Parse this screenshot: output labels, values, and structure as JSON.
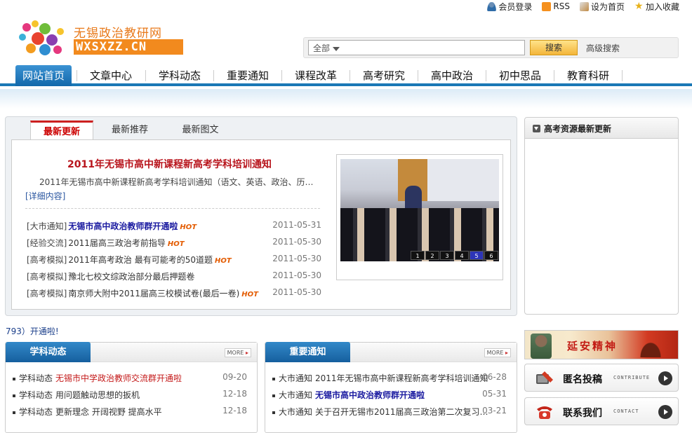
{
  "logo": {
    "brand": "无锡政治教研网",
    "domain": "WXSXZZ.CN"
  },
  "toplinks": [
    {
      "label": "会员登录",
      "icon": "user-icon"
    },
    {
      "label": "RSS",
      "icon": "rss-icon"
    },
    {
      "label": "设为首页",
      "icon": "home-icon"
    },
    {
      "label": "加入收藏",
      "icon": "star-icon"
    }
  ],
  "search": {
    "scope": "全部",
    "button": "搜索",
    "advanced": "高级搜索"
  },
  "nav": [
    "网站首页",
    "文章中心",
    "学科动态",
    "重要通知",
    "课程改革",
    "高考研究",
    "高中政治",
    "初中思品",
    "教育科研"
  ],
  "main": {
    "tabs": [
      "最新更新",
      "最新推荐",
      "最新图文"
    ],
    "featured": {
      "title": "2011年无锡市高中新课程新高考学科培训通知",
      "desc": "2011年无锡市高中新课程新高考学科培训通知（语文、英语、政治、历…",
      "more": "[详细内容]"
    },
    "news": [
      {
        "cat": "[大市通知]",
        "title": "无锡市高中政治教师群开通啦",
        "hot": "HOT",
        "date": "2011-05-31",
        "strong": true
      },
      {
        "cat": "[经验交流]",
        "title": "2011届高三政治考前指导",
        "hot": "HOT",
        "date": "2011-05-30",
        "strong": false
      },
      {
        "cat": "[高考模拟]",
        "title": "2011年高考政治 最有可能考的50道题",
        "hot": "HOT",
        "date": "2011-05-30",
        "strong": false
      },
      {
        "cat": "[高考模拟]",
        "title": "豫北七校文综政治部分最后押题卷",
        "hot": "",
        "date": "2011-05-30",
        "strong": false
      },
      {
        "cat": "[高考模拟]",
        "title": "南京师大附中2011届高三校模试卷(最后一卷)",
        "hot": "HOT",
        "date": "2011-05-30",
        "strong": false
      }
    ],
    "slider_pages": [
      "1",
      "2",
      "3",
      "4",
      "5",
      "6"
    ],
    "slider_active": 5
  },
  "side": {
    "title": "高考资源最新更新"
  },
  "ticker": "793）开通啦!",
  "panels": [
    {
      "title": "学科动态",
      "more": "MORE",
      "rows": [
        {
          "cat": "学科动态",
          "title": "无锡市中学政治教师交流群开通啦",
          "date": "09-20",
          "style": "red"
        },
        {
          "cat": "学科动态",
          "title": "用问题触动思想的扳机",
          "date": "12-18",
          "style": ""
        },
        {
          "cat": "学科动态",
          "title": "更新理念 开阔视野 提高水平",
          "date": "12-18",
          "style": ""
        }
      ]
    },
    {
      "title": "重要通知",
      "more": "MORE",
      "rows": [
        {
          "cat": "大市通知",
          "title": "2011年无锡市高中新课程新高考学科培训通知",
          "date": "06-28",
          "style": ""
        },
        {
          "cat": "大市通知",
          "title": "无锡市高中政治教师群开通啦",
          "date": "05-31",
          "style": "strong"
        },
        {
          "cat": "大市通知",
          "title": "关于召开无锡市2011届高三政治第二次复习…",
          "date": "03-21",
          "style": ""
        }
      ]
    }
  ],
  "banners": {
    "yanan": "延安精神",
    "contribute": {
      "label": "匿名投稿",
      "sub": "CONTRIBUTE"
    },
    "contact": {
      "label": "联系我们",
      "sub": "CONTACT"
    }
  },
  "colors": {
    "accent_blue": "#1a78b6",
    "brand_orange": "#f28a1e",
    "headline_red": "#b8141c",
    "hot_orange": "#e35b00"
  }
}
